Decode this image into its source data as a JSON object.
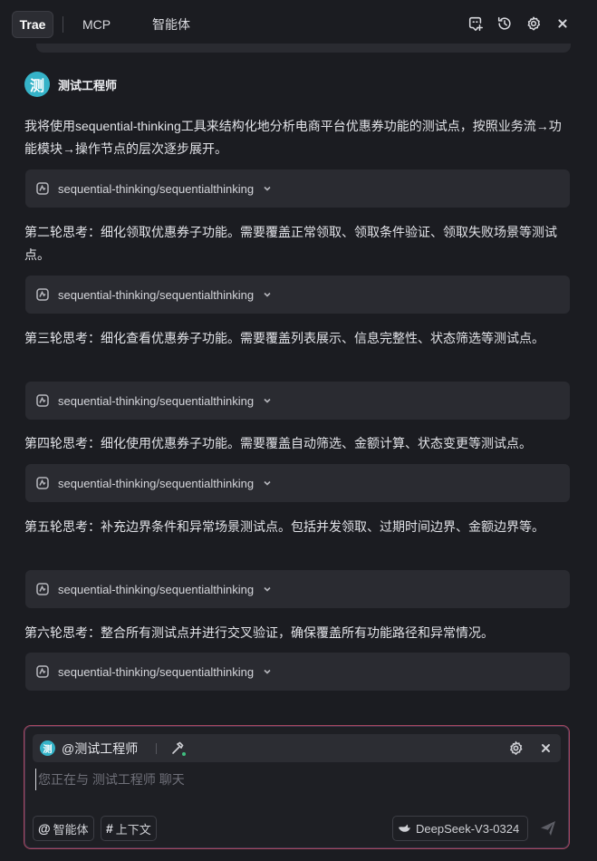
{
  "header": {
    "tabs": [
      {
        "label": "Trae",
        "active": true
      },
      {
        "label": "MCP",
        "active": false
      },
      {
        "label": "智能体",
        "active": false
      }
    ],
    "icons": [
      "new-chat-icon",
      "history-icon",
      "settings-icon",
      "close-icon"
    ]
  },
  "agent": {
    "avatar_char": "测",
    "name": "测试工程师",
    "color": "#35b3c8"
  },
  "messages": [
    {
      "text": "我将使用sequential-thinking工具来结构化地分析电商平台优惠券功能的测试点，按照业务流→功能模块→操作节点的层次逐步展开。",
      "tool": "sequential-thinking/sequentialthinking"
    },
    {
      "text": "第二轮思考：细化领取优惠券子功能。需要覆盖正常领取、领取条件验证、领取失败场景等测试点。",
      "tool": "sequential-thinking/sequentialthinking"
    },
    {
      "text": "第三轮思考：细化查看优惠券子功能。需要覆盖列表展示、信息完整性、状态筛选等测试点。",
      "tool": "sequential-thinking/sequentialthinking"
    },
    {
      "text": "第四轮思考：细化使用优惠券子功能。需要覆盖自动筛选、金额计算、状态变更等测试点。",
      "tool": "sequential-thinking/sequentialthinking"
    },
    {
      "text": "第五轮思考：补充边界条件和异常场景测试点。包括并发领取、过期时间边界、金额边界等。",
      "tool": "sequential-thinking/sequentialthinking"
    },
    {
      "text": "第六轮思考：整合所有测试点并进行交叉验证，确保覆盖所有功能路径和异常情况。",
      "tool": "sequential-thinking/sequentialthinking"
    }
  ],
  "input": {
    "mention_avatar_char": "测",
    "mention": "@测试工程师",
    "placeholder": "您正在与 测试工程师 聊天",
    "value": "",
    "chips": [
      {
        "symbol": "@",
        "label": "智能体"
      },
      {
        "symbol": "#",
        "label": "上下文"
      }
    ],
    "model": "DeepSeek-V3-0324"
  },
  "colors": {
    "background": "#1b1c21",
    "tool_card": "#2a2b31",
    "accent_avatar": "#35b3c8",
    "input_border": "#a5475f"
  }
}
